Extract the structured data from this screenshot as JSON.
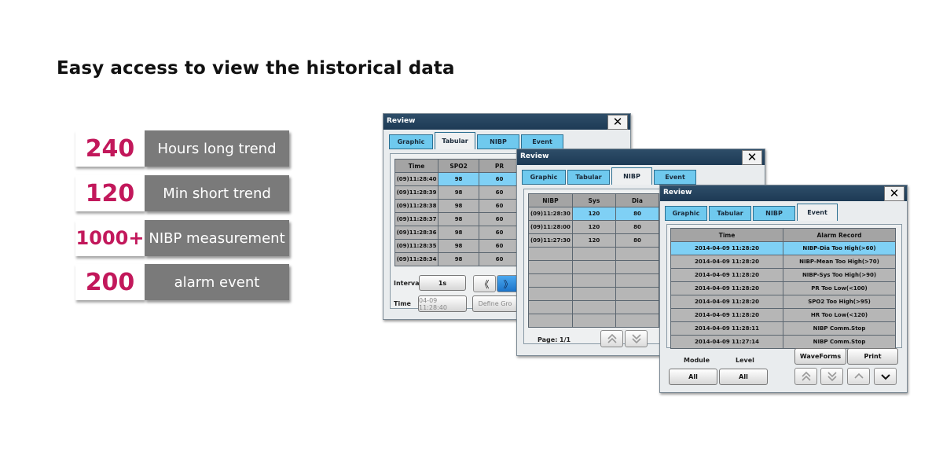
{
  "headline": "Easy access to view the historical data",
  "stats": [
    {
      "value": "240",
      "label": "Hours long trend"
    },
    {
      "value": "120",
      "label": "Min short trend"
    },
    {
      "value": "1000+",
      "label": "NIBP measurement"
    },
    {
      "value": "200",
      "label": "alarm event"
    }
  ],
  "close_glyph": "✕",
  "win1": {
    "title": "Review",
    "tabs": [
      "Graphic",
      "Tabular",
      "NIBP",
      "Event"
    ],
    "columns": [
      "Time",
      "SPO2",
      "PR"
    ],
    "rows": [
      [
        "(09)11:28:40",
        "98",
        "60"
      ],
      [
        "(09)11:28:39",
        "98",
        "60"
      ],
      [
        "(09)11:28:38",
        "98",
        "60"
      ],
      [
        "(09)11:28:37",
        "98",
        "60"
      ],
      [
        "(09)11:28:36",
        "98",
        "60"
      ],
      [
        "(09)11:28:35",
        "98",
        "60"
      ],
      [
        "(09)11:28:34",
        "98",
        "60"
      ]
    ],
    "interval_label": "Interval",
    "interval_value": "1s",
    "time_label": "Time",
    "time_value": "04-09 11:28:40",
    "define_button": "Define Gro",
    "arrow_left": "《",
    "arrow_right": "》"
  },
  "win2": {
    "title": "Review",
    "tabs": [
      "Graphic",
      "Tabular",
      "NIBP",
      "Event"
    ],
    "columns": [
      "NIBP",
      "Sys",
      "Dia"
    ],
    "rows": [
      [
        "(09)11:28:30",
        "120",
        "80"
      ],
      [
        "(09)11:28:00",
        "120",
        "80"
      ],
      [
        "(09)11:27:30",
        "120",
        "80"
      ]
    ],
    "page_label": "Page:",
    "page_value": "1/1"
  },
  "win3": {
    "title": "Review",
    "tabs": [
      "Graphic",
      "Tabular",
      "NIBP",
      "Event"
    ],
    "columns": [
      "Time",
      "Alarm Record"
    ],
    "rows": [
      [
        "2014-04-09 11:28:20",
        "NIBP-Dia Too High(>60)"
      ],
      [
        "2014-04-09 11:28:20",
        "NIBP-Mean Too High(>70)"
      ],
      [
        "2014-04-09 11:28:20",
        "NIBP-Sys Too High(>90)"
      ],
      [
        "2014-04-09 11:28:20",
        "PR Too Low(<100)"
      ],
      [
        "2014-04-09 11:28:20",
        "SPO2 Too High(>95)"
      ],
      [
        "2014-04-09 11:28:20",
        "HR Too Low(<120)"
      ],
      [
        "2014-04-09 11:28:11",
        "NIBP Comm.Stop"
      ],
      [
        "2014-04-09 11:27:14",
        "NIBP Comm.Stop"
      ]
    ],
    "waveforms_button": "WaveForms",
    "print_button": "Print",
    "module_label": "Module",
    "level_label": "Level",
    "module_value": "All",
    "level_value": "All"
  }
}
